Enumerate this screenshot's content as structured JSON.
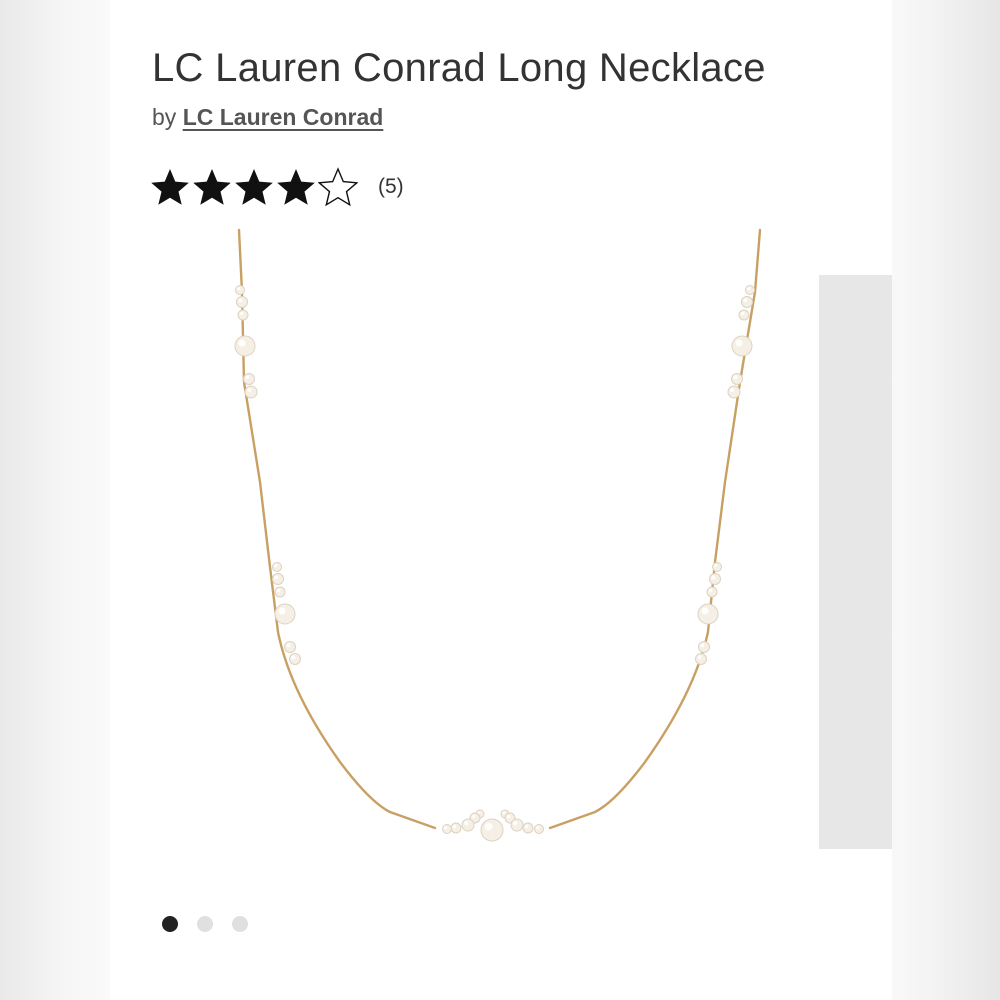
{
  "product": {
    "title": "LC Lauren Conrad Long Necklace",
    "by_prefix": "by",
    "brand": "LC Lauren Conrad",
    "rating": {
      "value": 4,
      "max": 5,
      "count_label": "(5)"
    },
    "image": {
      "alt": "Gold-tone chain necklace with pearl stations",
      "chain_color": "#c9a063",
      "pearl_color": "#f5efe6"
    }
  },
  "carousel": {
    "total_slides": 3,
    "active_index": 0
  },
  "colors": {
    "title": "#333333",
    "star_filled": "#111111",
    "dot_active": "#222222",
    "dot_inactive": "#e0e0e0"
  },
  "icons": {
    "star_filled": "star-filled-icon",
    "star_empty": "star-outline-icon"
  }
}
